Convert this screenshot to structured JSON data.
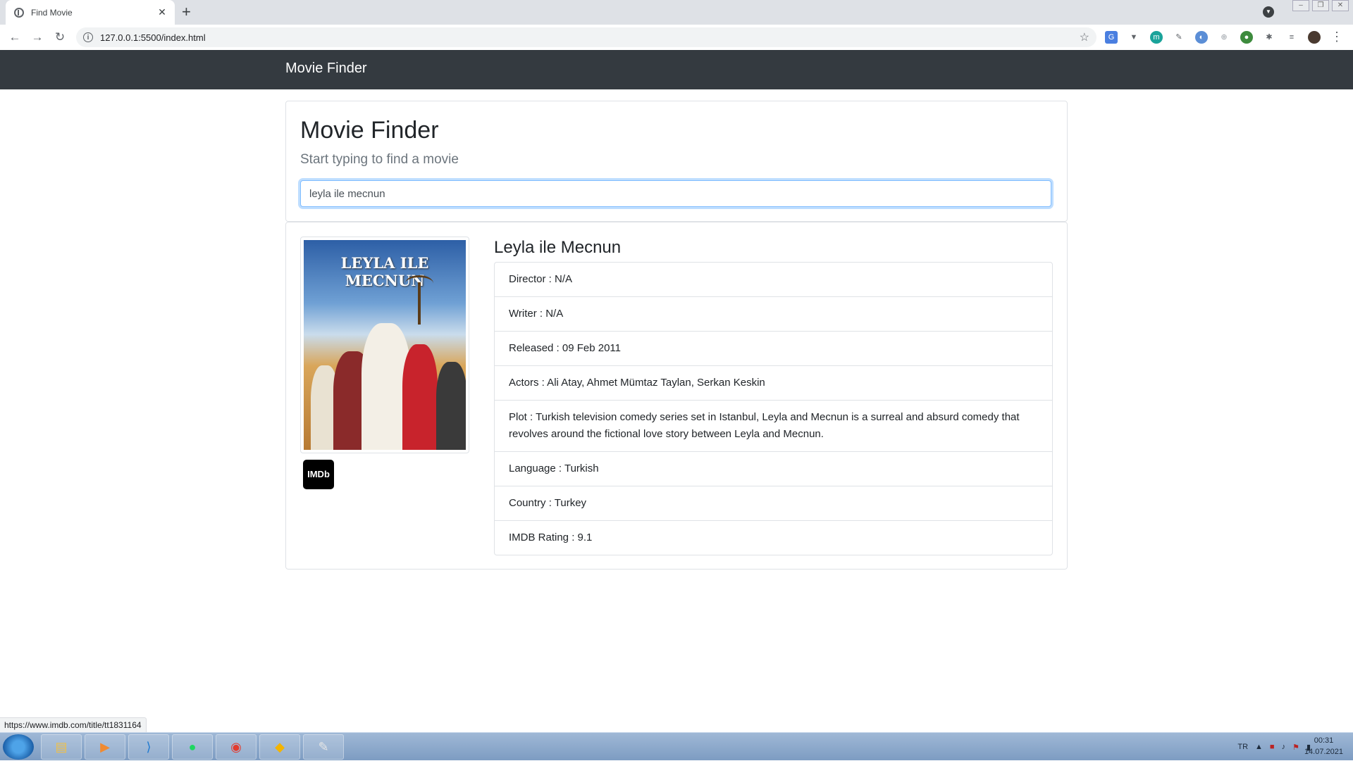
{
  "browser": {
    "tab_title": "Find Movie",
    "url": "127.0.0.1:5500/index.html",
    "status_url": "https://www.imdb.com/title/tt1831164"
  },
  "navbar": {
    "brand": "Movie Finder"
  },
  "search": {
    "heading": "Movie Finder",
    "lead": "Start typing to find a movie",
    "value": "leyla ile mecnun"
  },
  "movie": {
    "poster_title": "LEYLA ILE MECNUN",
    "imdb_badge": "IMDb",
    "title": "Leyla ile Mecnun",
    "details": [
      "Director : N/A",
      "Writer : N/A",
      "Released : 09 Feb 2011",
      "Actors : Ali Atay, Ahmet Mümtaz Taylan, Serkan Keskin",
      "Plot : Turkish television comedy series set in Istanbul, Leyla and Mecnun is a surreal and absurd comedy that revolves around the fictional love story between Leyla and Mecnun.",
      "Language : Turkish",
      "Country : Turkey",
      "IMDB Rating : 9.1"
    ]
  },
  "taskbar": {
    "language": "TR",
    "time": "00:31",
    "date": "14.07.2021"
  },
  "colors": {
    "navbar": "#343a40",
    "input_focus": "#80bdff"
  }
}
